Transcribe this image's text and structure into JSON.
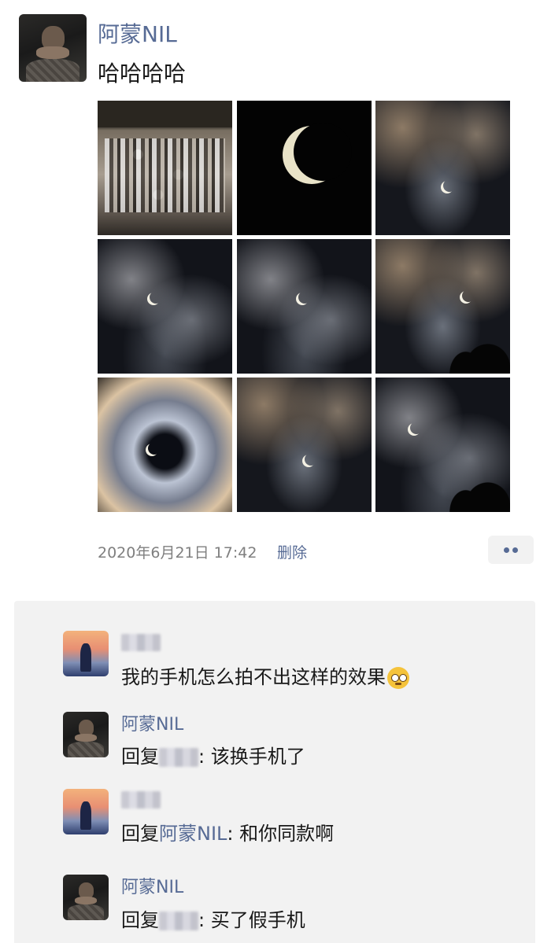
{
  "post": {
    "author": "阿蒙NIL",
    "text": "哈哈哈哈",
    "timestamp": "2020年6月21日 17:42",
    "delete_label": "删除",
    "more_icon": "more-dots-icon",
    "photos": [
      "crowd-photo",
      "crescent-moon-photo",
      "eclipse-cloud-photo",
      "eclipse-cloud-photo",
      "eclipse-cloud-photo",
      "eclipse-cloud-photo",
      "eclipse-ring-cloud-photo",
      "eclipse-cloud-photo",
      "eclipse-tree-silhouette-photo"
    ]
  },
  "comments": [
    {
      "author": "",
      "text": "我的手机怎么拍不出这样的效果",
      "emoji": "pleading-face-emoji"
    },
    {
      "author": "阿蒙NIL",
      "reply_prefix": "回复",
      "text": ": 该换手机了"
    },
    {
      "author": "",
      "reply_prefix": "回复",
      "reply_to": "阿蒙NIL",
      "text": ": 和你同款啊"
    },
    {
      "author": "阿蒙NIL",
      "reply_prefix": "回复",
      "text": ": 买了假手机"
    }
  ],
  "colors": {
    "link": "#576b95",
    "comment_bg": "#f2f2f2",
    "meta_text": "#7f7f7f"
  }
}
